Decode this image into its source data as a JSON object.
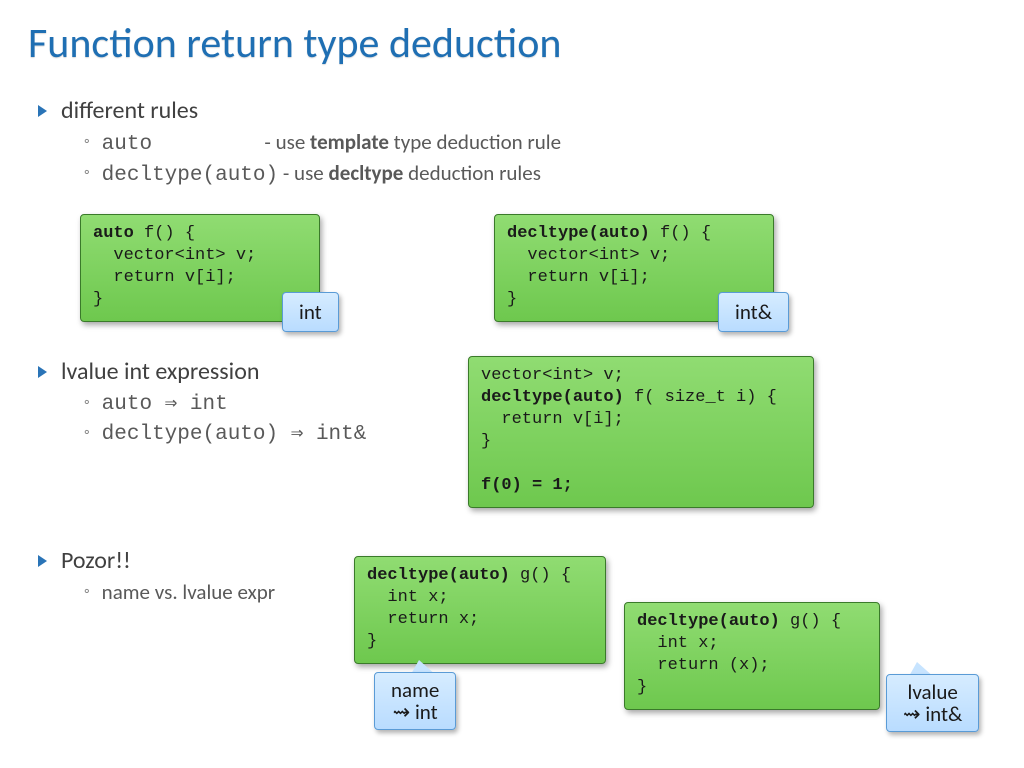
{
  "title": "Function return type deduction",
  "bullets": {
    "s1": {
      "head": "different rules",
      "r1a": "auto",
      "r1b": "- use ",
      "r1c": "template",
      "r1d": " type deduction rule",
      "r2a": "decltype(auto)",
      "r2b": " - use ",
      "r2c": "decltype",
      "r2d": " deduction rules"
    },
    "s2": {
      "head": "lvalue int expression",
      "r1": "auto ⇒ int",
      "r2": "decltype(auto) ⇒ int&"
    },
    "s3": {
      "head": "Pozor!!",
      "r1": "name vs. lvalue expr"
    }
  },
  "code": {
    "c1_l1": "auto",
    "c1_l1b": " f() {",
    "c1_l2": "  vector<int> v;",
    "c1_l3": "  return v[i];",
    "c1_l4": "}",
    "c2_l1": "decltype(auto)",
    "c2_l1b": " f() {",
    "c3_l1": "vector<int> v;",
    "c3_l2": "decltype(auto)",
    "c3_l2b": " f( size_t i) {",
    "c3_l3": "  return v[i];",
    "c3_l4": "}",
    "c3_l5": "",
    "c3_l6": "f(0) = 1;",
    "c4_l1": "decltype(auto)",
    "c4_l1b": " g() {",
    "c4_l2": "  int x;",
    "c4_l3": "  return x;",
    "c4_l4": "}",
    "c5_l1": "decltype(auto)",
    "c5_l1b": " g() {",
    "c5_l2": "  int x;",
    "c5_l3": "  return (x);",
    "c5_l4": "}"
  },
  "badges": {
    "b1": "int",
    "b2": "int&",
    "b3a": "name",
    "b3b": "⇝ int",
    "b4a": "lvalue",
    "b4b": "⇝ int&"
  }
}
